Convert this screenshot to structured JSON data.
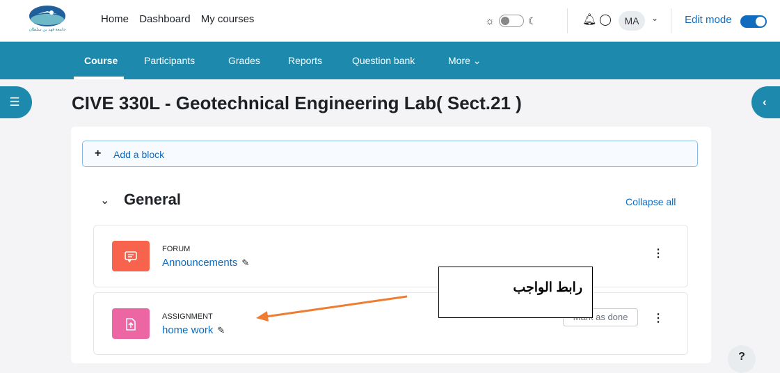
{
  "navbar": {
    "logo_text": "جامعة فهد بن سلطان",
    "links": [
      "Home",
      "Dashboard",
      "My courses"
    ],
    "user_initials": "MA",
    "edit_mode_label": "Edit mode"
  },
  "secondary_nav": {
    "tabs": [
      "Course",
      "Participants",
      "Grades",
      "Reports",
      "Question bank",
      "More ⌄"
    ],
    "active": "Course"
  },
  "page": {
    "title": "CIVE 330L - Geotechnical Engineering Lab( Sect.21 )"
  },
  "add_block": {
    "label": "Add a block"
  },
  "section": {
    "title": "General",
    "collapse_all": "Collapse all"
  },
  "activities": [
    {
      "type": "FORUM",
      "name": "Announcements",
      "color": "#f7634d"
    },
    {
      "type": "ASSIGNMENT",
      "name": "home work",
      "color": "#eb66a2",
      "mark_done": "Mark as done"
    }
  ],
  "annotation": {
    "text": "رابط الواجب",
    "arrow_color": "#ee7d31"
  },
  "help": "?"
}
